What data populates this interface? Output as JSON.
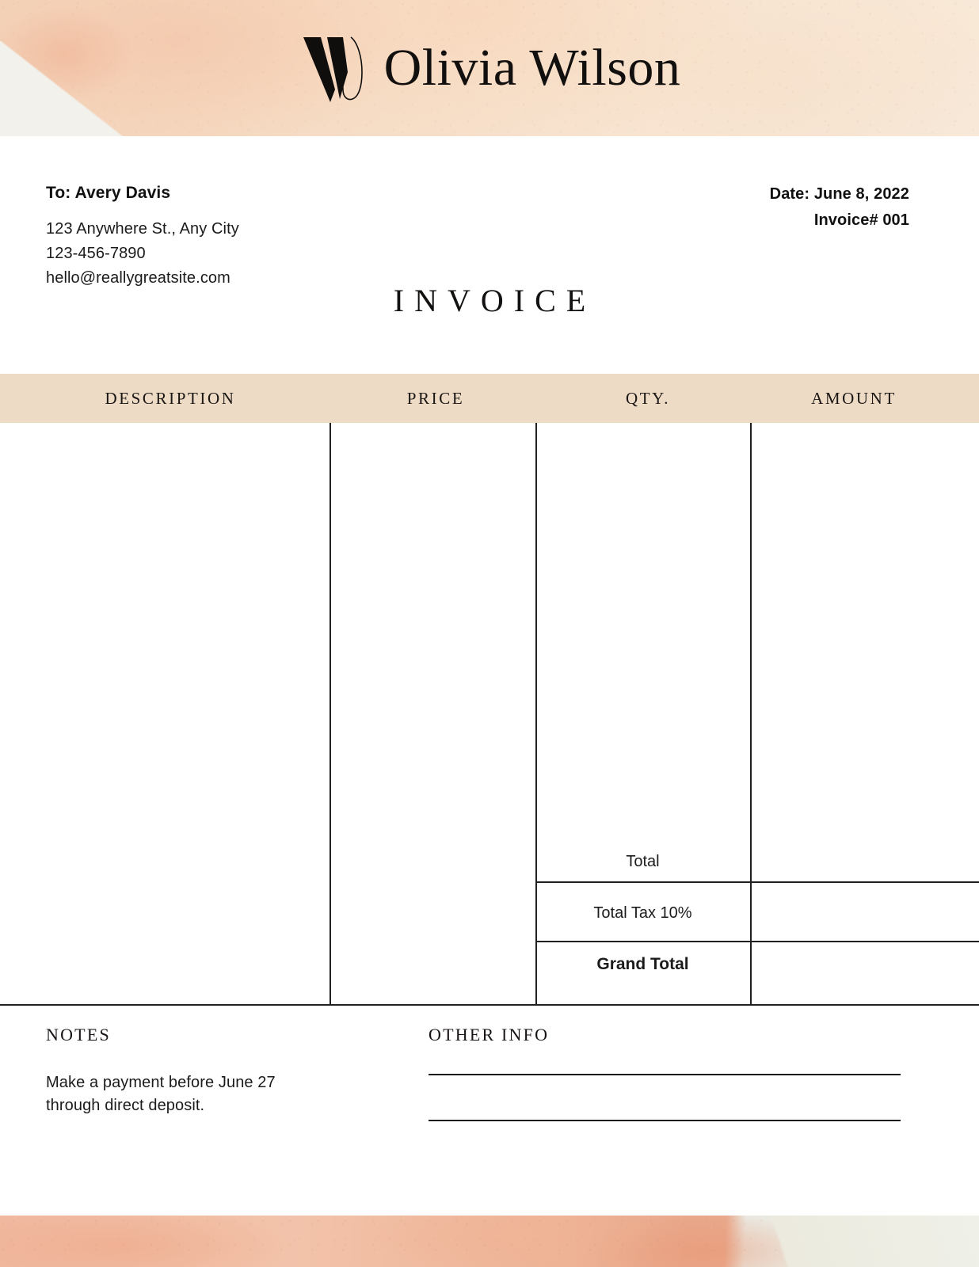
{
  "brand": {
    "monogram": "W",
    "monogram_icon": "w-monogram-icon",
    "name": "Olivia Wilson"
  },
  "bill_to": {
    "name": "To: Avery Davis",
    "address": "123 Anywhere St., Any City",
    "phone": "123-456-7890",
    "email": "hello@reallygreatsite.com"
  },
  "meta": {
    "date": "Date: June 8, 2022",
    "invoice_number": "Invoice# 001"
  },
  "document_title": "INVOICE",
  "table": {
    "columns": [
      "DESCRIPTION",
      "PRICE",
      "QTY.",
      "AMOUNT"
    ],
    "rows": [],
    "totals": [
      {
        "label": "Total",
        "value": ""
      },
      {
        "label": "Total Tax 10%",
        "value": ""
      },
      {
        "label": "Grand Total",
        "value": ""
      }
    ]
  },
  "notes": {
    "title": "NOTES",
    "line1": "Make a payment before June 27",
    "line2": "through direct deposit."
  },
  "other_info": {
    "title": "OTHER INFO",
    "field1": "",
    "field2": ""
  },
  "colors": {
    "table_header_band": "#EDDBC5",
    "header_wash": "#F6DDC6",
    "footer_wash": "#F0B9A0",
    "rule": "#22201F",
    "text": "#1B1B1B"
  }
}
